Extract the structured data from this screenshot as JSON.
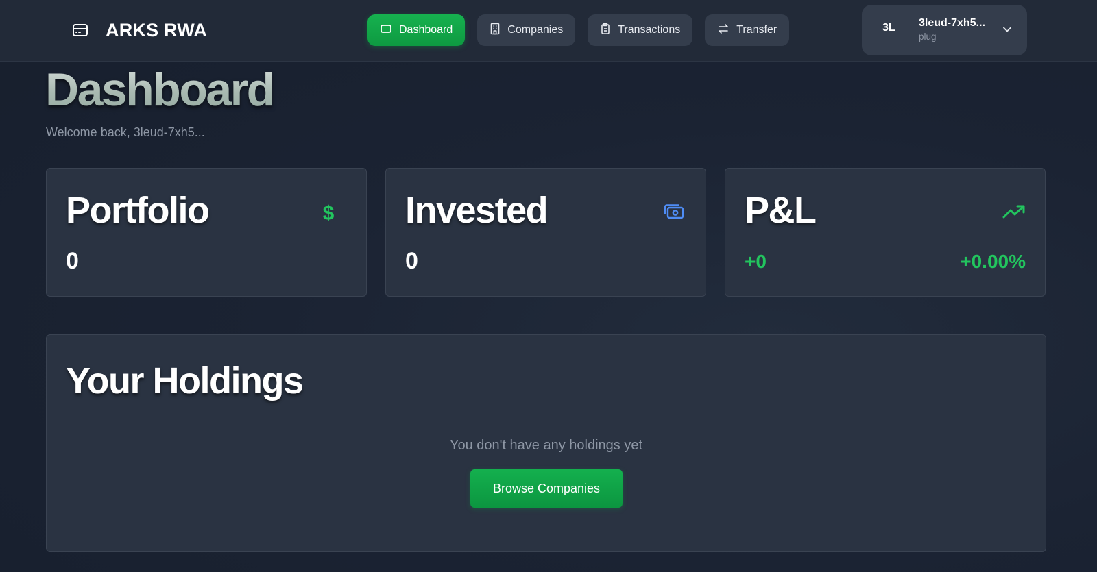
{
  "brand": {
    "name": "ARKS RWA",
    "icon": "wallet-icon"
  },
  "nav": {
    "items": [
      {
        "label": "Dashboard",
        "icon": "dashboard-icon",
        "active": true
      },
      {
        "label": "Companies",
        "icon": "building-icon",
        "active": false
      },
      {
        "label": "Transactions",
        "icon": "receipt-icon",
        "active": false
      },
      {
        "label": "Transfer",
        "icon": "transfer-arrows-icon",
        "active": false
      }
    ]
  },
  "user": {
    "initials": "3L",
    "name": "3leud-7xh5...",
    "wallet": "plug"
  },
  "page": {
    "title": "Dashboard",
    "welcome": "Welcome back, 3leud-7xh5..."
  },
  "cards": {
    "portfolio": {
      "title": "Portfolio",
      "value": "0",
      "icon": "dollar-icon"
    },
    "invested": {
      "title": "Invested",
      "value": "0",
      "icon": "cash-icon"
    },
    "pnl": {
      "title": "P&L",
      "value": "+0",
      "percent": "+0.00%",
      "icon": "trending-up-icon"
    }
  },
  "holdings": {
    "title": "Your Holdings",
    "empty_message": "You don't have any holdings yet",
    "browse_label": "Browse Companies"
  },
  "colors": {
    "accent": "#16b14f",
    "positive": "#22c55e",
    "invested_icon": "#4f8df5",
    "background": "#1a2232",
    "card": "#2a3342"
  }
}
